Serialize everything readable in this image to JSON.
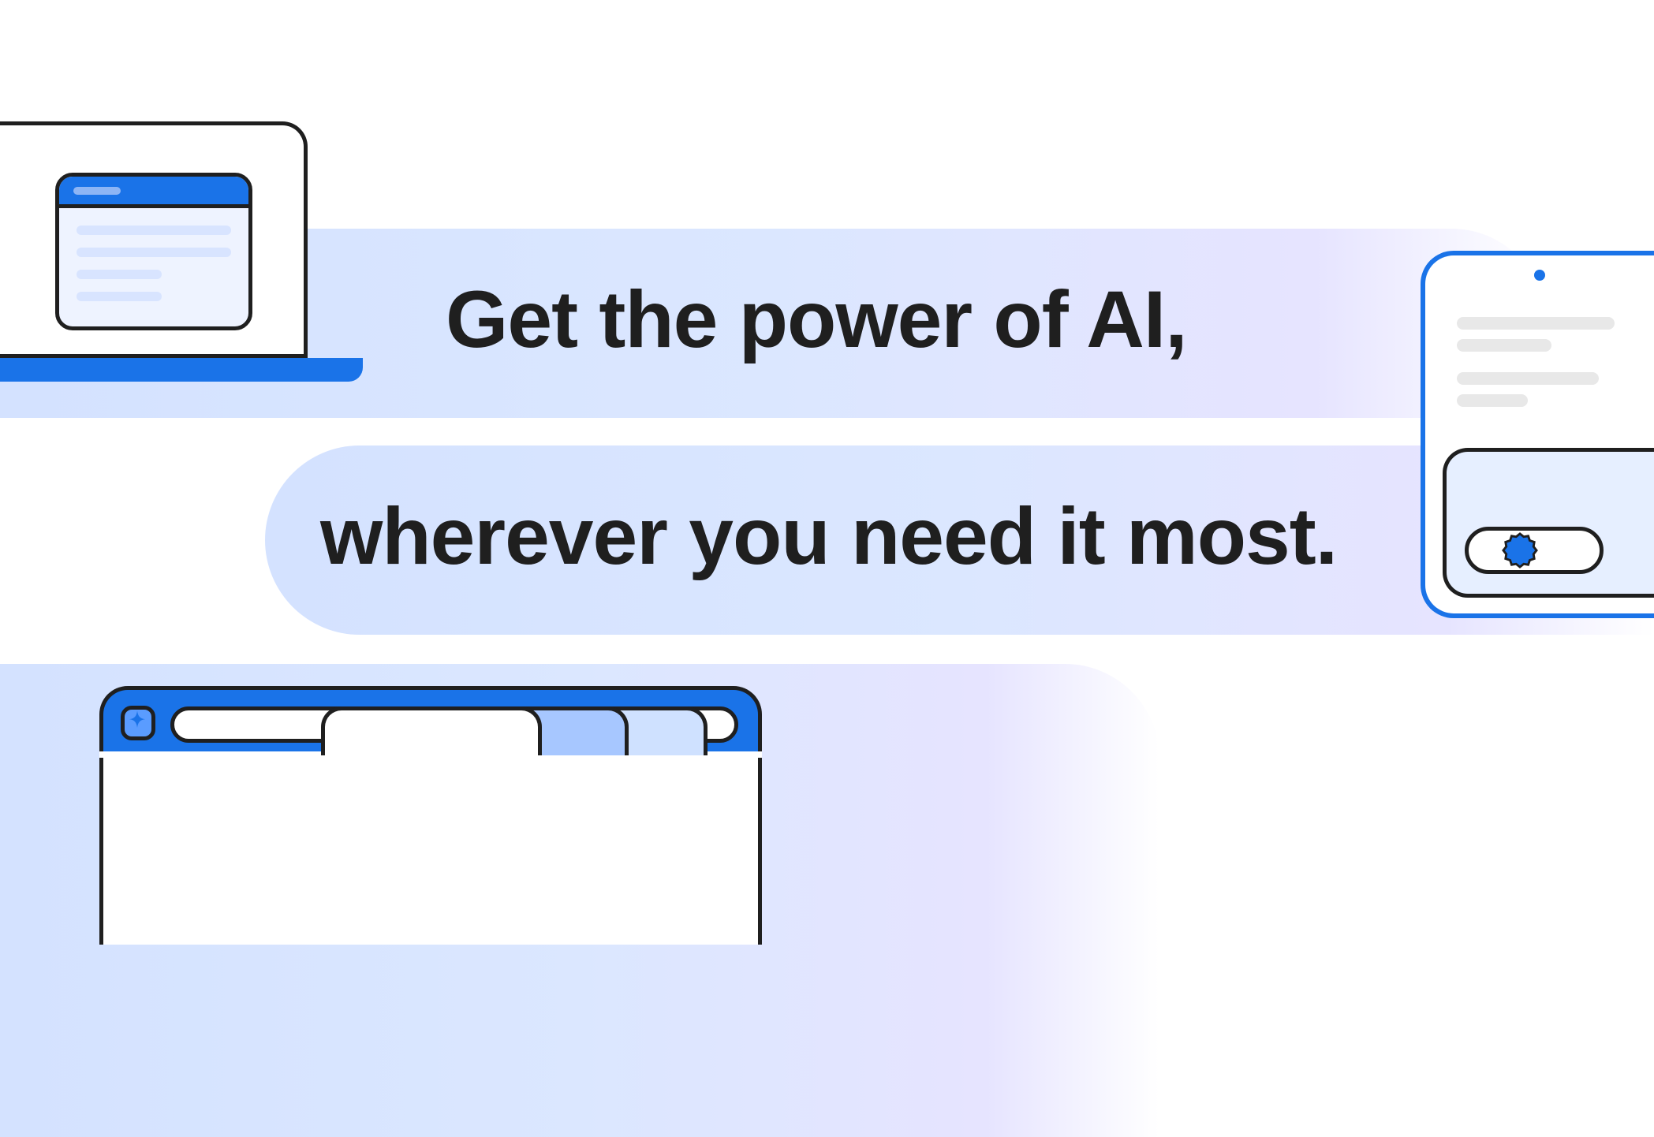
{
  "headline": {
    "line1": "Get the power of AI,",
    "line2": "wherever you need it most."
  },
  "colors": {
    "accent": "#1a73e8",
    "text": "#1f1f1f",
    "bubble_start": "#d4e2ff",
    "bubble_end": "#e6e4ff"
  },
  "illustrations": {
    "laptop": "laptop-with-app-window",
    "phone": "phone-with-toggle-badge",
    "browser": "browser-tabs-with-omnibox"
  }
}
